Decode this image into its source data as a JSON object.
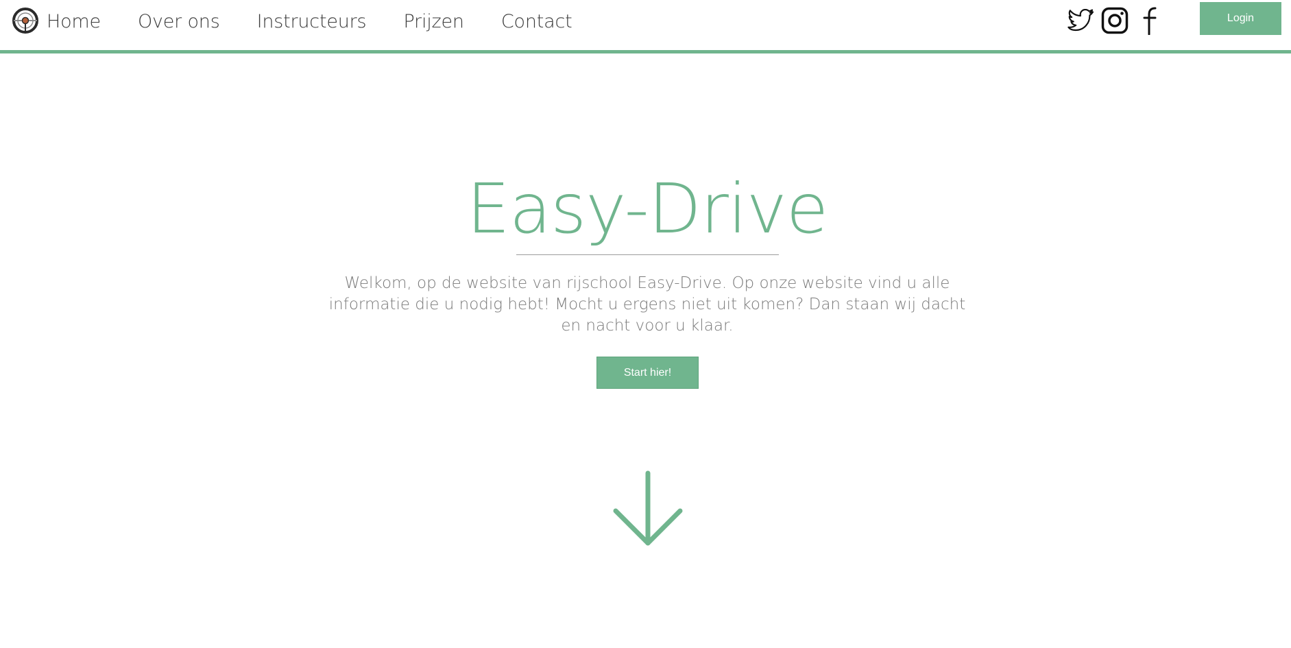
{
  "nav": {
    "items": [
      {
        "label": "Home"
      },
      {
        "label": "Over ons"
      },
      {
        "label": "Instructeurs"
      },
      {
        "label": "Prijzen"
      },
      {
        "label": "Contact"
      }
    ],
    "social": [
      "twitter-icon",
      "instagram-icon",
      "facebook-icon"
    ],
    "login_label": "Login"
  },
  "hero": {
    "title": "Easy-Drive",
    "text": "Welkom, op de website van rijschool Easy-Drive. Op onze website vind u alle informatie die u nodig hebt! Mocht u ergens niet uit komen? Dan staan wij dacht en nacht voor u klaar.",
    "button_label": "Start hier!"
  },
  "colors": {
    "accent": "#70b58e",
    "text": "#3a3a3a",
    "muted_text": "#7a7a7a",
    "background": "#ffffff"
  }
}
